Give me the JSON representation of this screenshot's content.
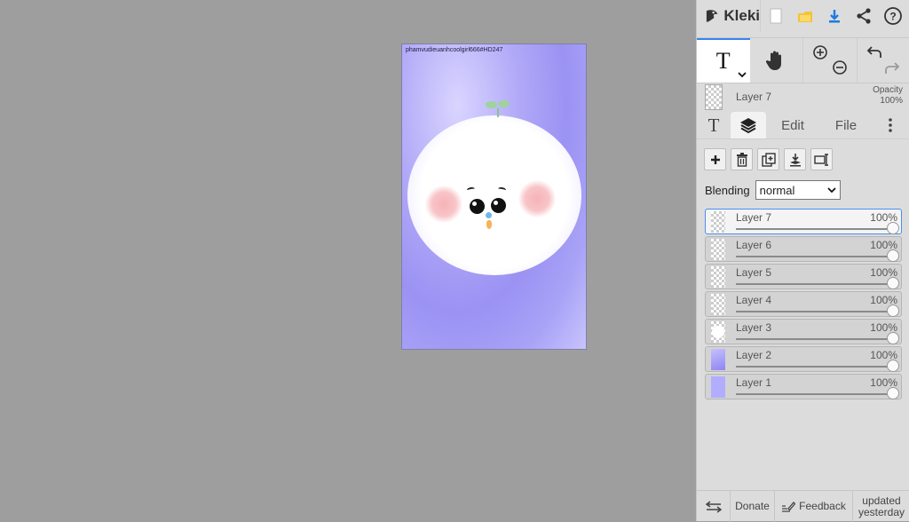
{
  "app": {
    "name": "Kleki"
  },
  "canvas": {
    "watermark": "phamvudieuanhcoolgirl666#HD247"
  },
  "tools": {
    "text_glyph": "T"
  },
  "current_layer": {
    "name": "Layer 7",
    "opacity_label": "Opacity",
    "opacity_value": "100%"
  },
  "tabs": {
    "text": "T",
    "edit": "Edit",
    "file": "File"
  },
  "blending": {
    "label": "Blending",
    "value": "normal"
  },
  "layers": [
    {
      "name": "Layer 7",
      "opacity": "100%"
    },
    {
      "name": "Layer 6",
      "opacity": "100%"
    },
    {
      "name": "Layer 5",
      "opacity": "100%"
    },
    {
      "name": "Layer 4",
      "opacity": "100%"
    },
    {
      "name": "Layer 3",
      "opacity": "100%"
    },
    {
      "name": "Layer 2",
      "opacity": "100%"
    },
    {
      "name": "Layer 1",
      "opacity": "100%"
    }
  ],
  "bottom": {
    "donate": "Donate",
    "feedback": "Feedback",
    "updated_line1": "updated",
    "updated_line2": "yesterday"
  },
  "colors": {
    "accent": "#3a83f1",
    "panel": "#dcdcdc",
    "workspace": "#9e9e9e"
  }
}
